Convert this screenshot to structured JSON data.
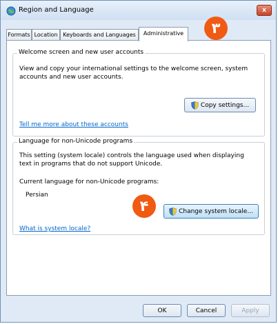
{
  "window": {
    "title": "Region and Language",
    "close_glyph": "x"
  },
  "tabs": [
    {
      "label": "Formats",
      "active": false
    },
    {
      "label": "Location",
      "active": false
    },
    {
      "label": "Keyboards and Languages",
      "active": false
    },
    {
      "label": "Administrative",
      "active": true
    }
  ],
  "welcome_group": {
    "title": "Welcome screen and new user accounts",
    "description": "View and copy your international settings to the welcome screen, system accounts and new user accounts.",
    "copy_button": "Copy settings...",
    "link": "Tell me more about these accounts"
  },
  "locale_group": {
    "title": "Language for non-Unicode programs",
    "description": "This setting (system locale) controls the language used when displaying text in programs that do not support Unicode.",
    "current_label": "Current language for non-Unicode programs:",
    "current_value": "Persian",
    "change_button": "Change system locale...",
    "link": "What is system locale?"
  },
  "footer": {
    "ok": "OK",
    "cancel": "Cancel",
    "apply": "Apply"
  },
  "annotations": {
    "badge_3": "٣",
    "badge_4": "۴"
  },
  "colors": {
    "badge": "#f05a12",
    "link": "#0066cc",
    "window_frame": "#dfeaf6"
  },
  "icons": {
    "title": "globe-icon",
    "shield": "uac-shield-icon"
  }
}
